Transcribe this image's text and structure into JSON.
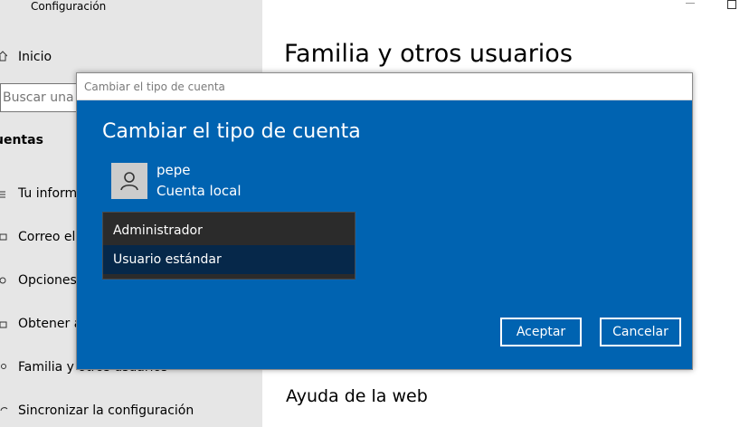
{
  "app": {
    "title": "Configuración"
  },
  "sidebar": {
    "home_label": "Inicio",
    "search_placeholder": "Buscar una co",
    "section_title": "uentas",
    "items": [
      {
        "label": "Tu informa"
      },
      {
        "label": "Correo elec"
      },
      {
        "label": "Opciones d"
      },
      {
        "label": "Obtener ac"
      },
      {
        "label": "Familia y otros usuarios"
      },
      {
        "label": "Sincronizar la configuración"
      }
    ]
  },
  "main": {
    "title": "Familia y otros usuarios",
    "web_help": "Ayuda de la web"
  },
  "dialog": {
    "window_title": "Cambiar el tipo de cuenta",
    "heading": "Cambiar el tipo de cuenta",
    "user": {
      "name": "pepe",
      "account_type": "Cuenta local"
    },
    "options": [
      "Administrador",
      "Usuario estándar"
    ],
    "highlighted_option": "Usuario estándar",
    "ok_label": "Aceptar",
    "cancel_label": "Cancelar"
  },
  "colors": {
    "dialog_bg": "#0063b1",
    "dropdown_bg": "#2b2b2b",
    "dropdown_highlight": "#06284a",
    "sidebar_bg": "#e6e6e6"
  },
  "icons": {
    "avatar": "person-icon",
    "home": "home-icon",
    "nav": "nav-icon"
  }
}
